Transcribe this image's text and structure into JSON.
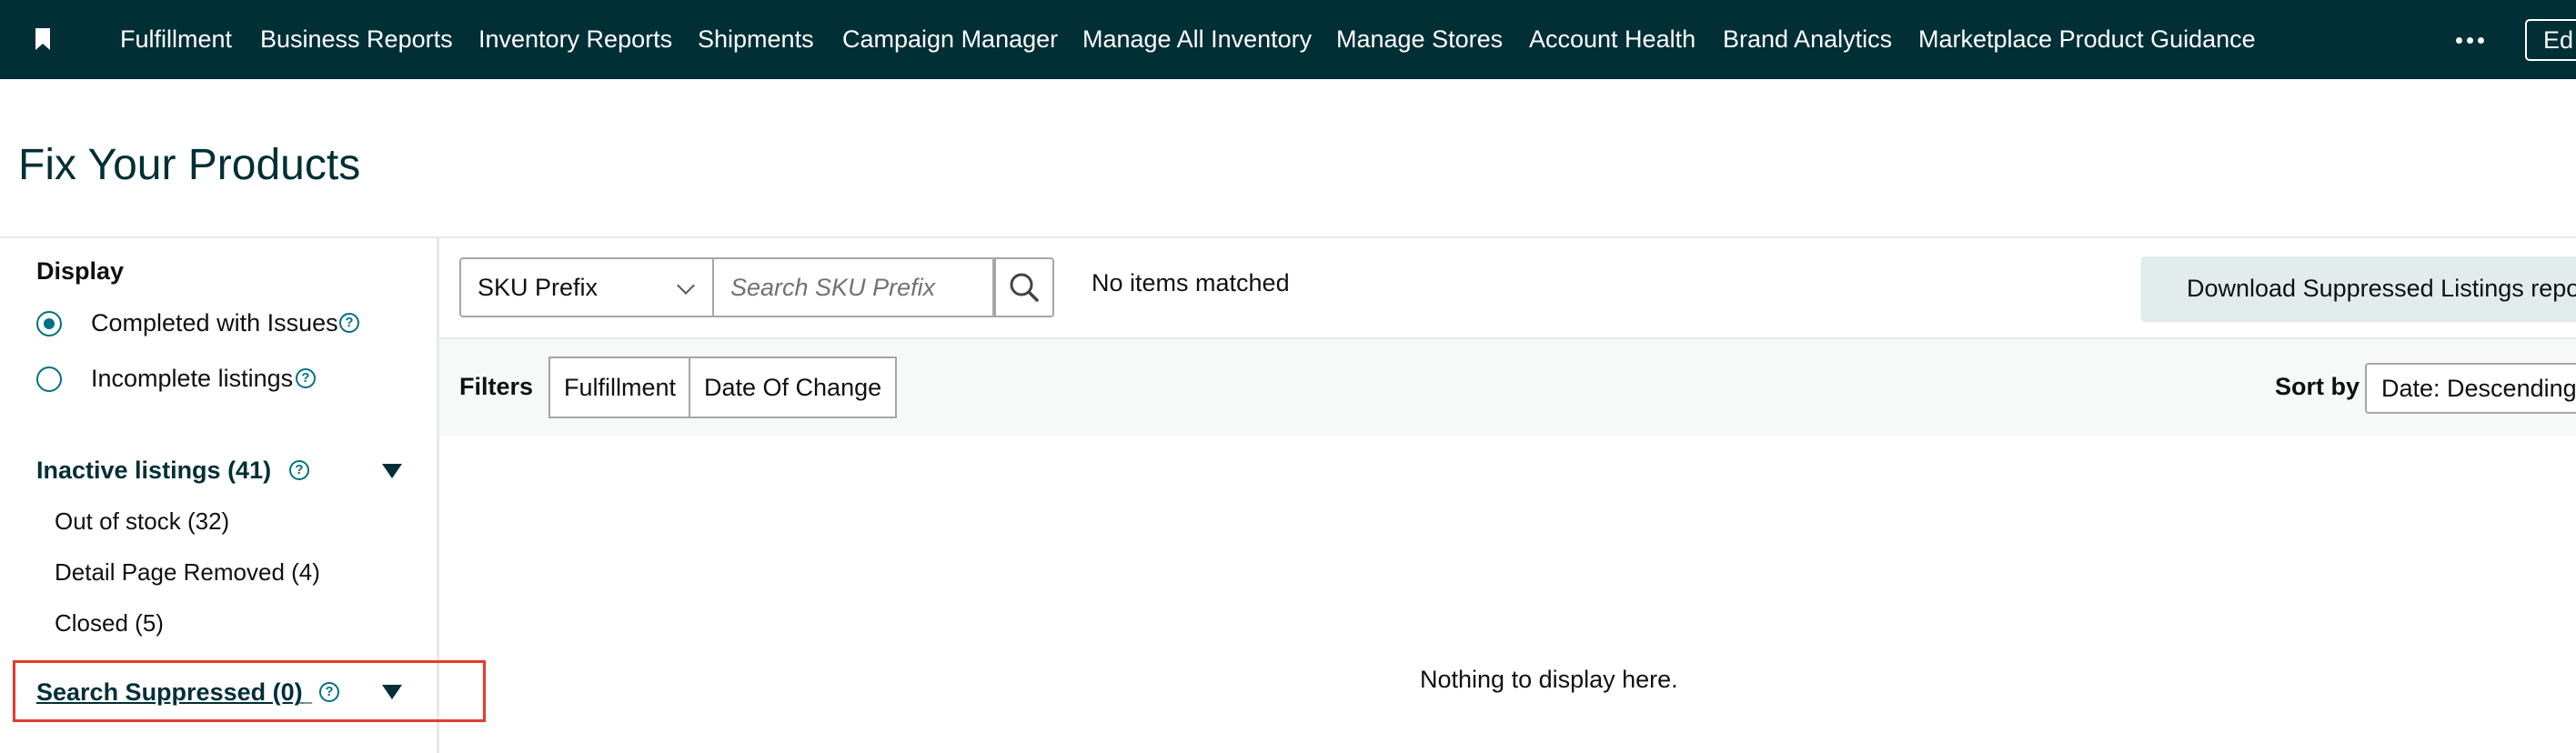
{
  "nav": {
    "links": [
      "Fulfillment",
      "Business Reports",
      "Inventory Reports",
      "Shipments",
      "Campaign Manager",
      "Manage All Inventory",
      "Manage Stores",
      "Account Health",
      "Brand Analytics",
      "Marketplace Product Guidance"
    ],
    "edit_label": "Ed",
    "more_icon": "more-dots-icon",
    "bookmark_icon": "bookmark-icon"
  },
  "page": {
    "title": "Fix Your Products"
  },
  "sidebar": {
    "display_heading": "Display",
    "options": [
      {
        "label": "Completed with Issues",
        "checked": true
      },
      {
        "label": "Incomplete listings",
        "checked": false
      }
    ],
    "inactive": {
      "title": "Inactive listings (41)",
      "items": [
        "Out of stock (32)",
        "Detail Page Removed (4)",
        "Closed (5)"
      ]
    },
    "suppressed": {
      "title": "Search Suppressed (0)",
      "trailing": "_"
    },
    "help_glyph": "?"
  },
  "search": {
    "select_value": "SKU Prefix",
    "placeholder": "Search SKU Prefix",
    "status": "No items matched"
  },
  "download_label": "Download Suppressed Listings report",
  "filters": {
    "label": "Filters",
    "buttons": [
      "Fulfillment",
      "Date Of Change"
    ]
  },
  "sort": {
    "label": "Sort by",
    "value": "Date: Descending"
  },
  "empty_message": "Nothing to display here.",
  "colors": {
    "nav_bg": "#002f36",
    "accent": "#007185",
    "highlight": "#e53b2c"
  }
}
